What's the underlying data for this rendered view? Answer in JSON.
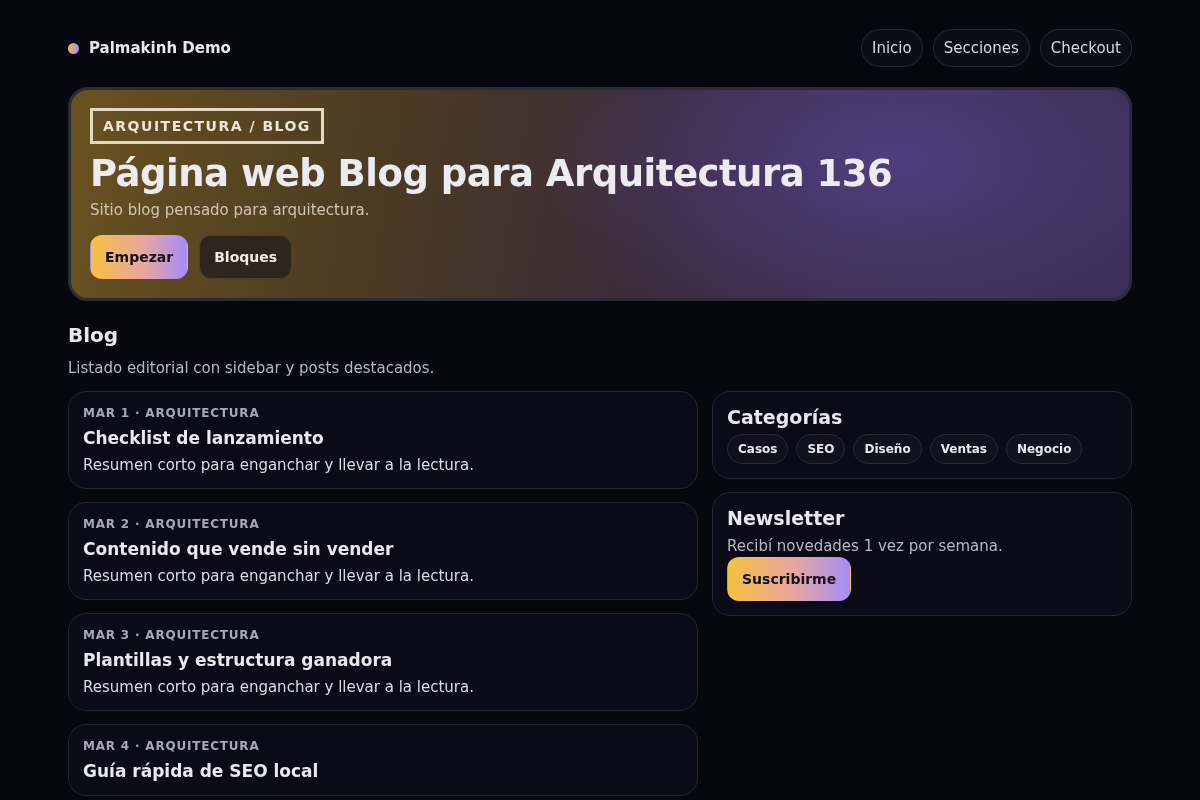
{
  "brand": {
    "name": "Palmakinh Demo"
  },
  "nav": [
    {
      "label": "Inicio"
    },
    {
      "label": "Secciones"
    },
    {
      "label": "Checkout"
    }
  ],
  "hero": {
    "tag": "ARQUITECTURA / BLOG",
    "title": "Página web Blog para Arquitectura 136",
    "subtitle": "Sitio blog pensado para arquitectura.",
    "buttons": [
      {
        "label": "Empezar",
        "kind": "primary"
      },
      {
        "label": "Bloques",
        "kind": "secondary"
      }
    ]
  },
  "section": {
    "title": "Blog",
    "description": "Listado editorial con sidebar y posts destacados."
  },
  "posts": [
    {
      "meta": "MAR 1 · ARQUITECTURA",
      "title": "Checklist de lanzamiento",
      "summary": "Resumen corto para enganchar y llevar a la lectura."
    },
    {
      "meta": "MAR 2 · ARQUITECTURA",
      "title": "Contenido que vende sin vender",
      "summary": "Resumen corto para enganchar y llevar a la lectura."
    },
    {
      "meta": "MAR 3 · ARQUITECTURA",
      "title": "Plantillas y estructura ganadora",
      "summary": "Resumen corto para enganchar y llevar a la lectura."
    },
    {
      "meta": "MAR 4 · ARQUITECTURA",
      "title": "Guía rápida de SEO local"
    }
  ],
  "categories": {
    "title": "Categorías",
    "items": [
      "Casos",
      "SEO",
      "Diseño",
      "Ventas",
      "Negocio"
    ]
  },
  "newsletter": {
    "title": "Newsletter",
    "text": "Recibí novedades 1 vez por semana.",
    "button": "Suscribirme"
  }
}
